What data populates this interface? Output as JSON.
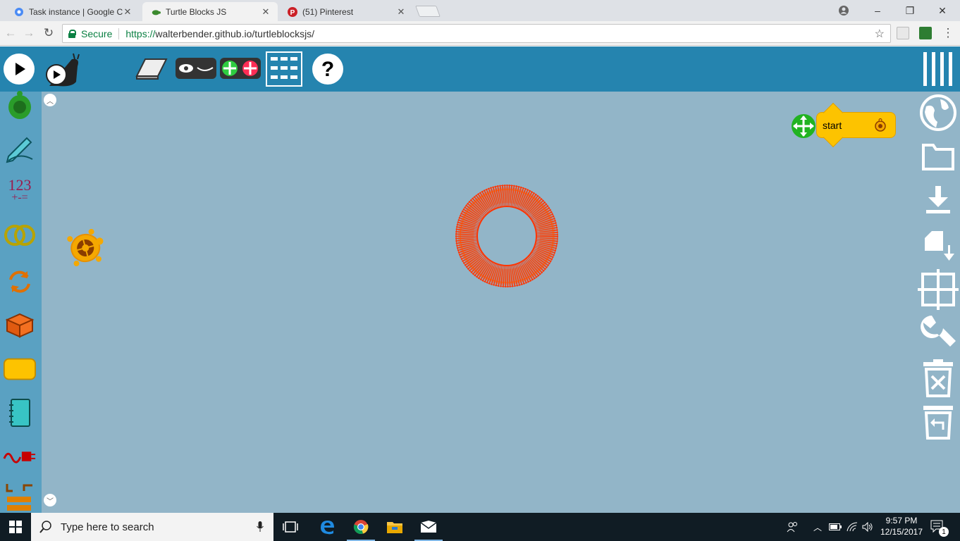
{
  "browser": {
    "tabs": [
      {
        "label": "Task instance | Google C",
        "icon": "gear-favicon",
        "close": "✕",
        "active": false
      },
      {
        "label": "Turtle Blocks JS",
        "icon": "turtle-favicon",
        "close": "✕",
        "active": true
      },
      {
        "label": "(51) Pinterest",
        "icon": "pinterest-favicon",
        "close": "✕",
        "active": false
      }
    ],
    "security_label": "Secure",
    "url_scheme": "https://",
    "url_rest": "walterbender.github.io/turtleblocksjs/",
    "window_controls": {
      "minimize": "–",
      "maximize": "❐",
      "close": "✕"
    }
  },
  "app": {
    "header_icons": [
      "run-icon",
      "run-slow-icon",
      "clear-icon",
      "hide-blocks-icon",
      "collapse-expand-icon",
      "grid-menu-icon",
      "help-icon",
      "main-menu-icon"
    ],
    "palette_items": [
      "turtle-palette",
      "pen-palette",
      "number-palette",
      "boolean-palette",
      "flow-palette",
      "box-palette",
      "action-palette",
      "media-palette",
      "sensors-palette",
      "extras-palette"
    ],
    "palette_labels": {
      "number_top": "123",
      "number_bottom": "+-="
    },
    "right_icons": [
      "planet-icon",
      "open-file-icon",
      "save-icon",
      "load-plugin-icon",
      "grid-icon",
      "settings-icon",
      "delete-all-icon",
      "restore-trash-icon"
    ],
    "start_block_label": "start",
    "colors": {
      "header": "#2584af",
      "palette": "#5aa1c2",
      "canvas": "#92b5c8",
      "start_block": "#fdc300",
      "drawing": "#ff3300"
    }
  },
  "taskbar": {
    "search_placeholder": "Type here to search",
    "time": "9:57 PM",
    "date": "12/15/2017",
    "notification_count": "1"
  }
}
